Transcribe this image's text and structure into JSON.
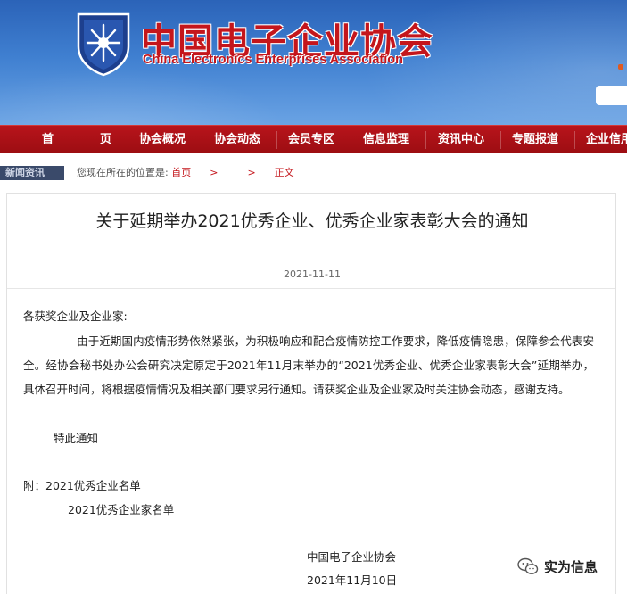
{
  "header": {
    "org_name_cn": "中国电子企业协会",
    "org_name_en": "China Electronics Enterprises Association"
  },
  "nav": {
    "items": [
      {
        "label": "首"
      },
      {
        "label": "页"
      },
      {
        "label": "协会概况"
      },
      {
        "label": "协会动态"
      },
      {
        "label": "会员专区"
      },
      {
        "label": "信息监理"
      },
      {
        "label": "资讯中心"
      },
      {
        "label": "专题报道"
      },
      {
        "label": "企业信用"
      }
    ]
  },
  "breadcrumb": {
    "tag": "新闻资讯",
    "prefix": "您现在所在的位置是:",
    "home": "首页",
    "sep1": ">",
    "sep2": ">",
    "current": "正文"
  },
  "article": {
    "title": "关于延期举办2021优秀企业、优秀企业家表彰大会的通知",
    "date": "2021-11-11",
    "salutation": "各获奖企业及企业家:",
    "body": "由于近期国内疫情形势依然紧张，为积极响应和配合疫情防控工作要求，降低疫情隐患，保障参会代表安全。经协会秘书处办公会研究决定原定于2021年11月末举办的“2021优秀企业、优秀企业家表彰大会”延期举办，具体召开时间，将根据疫情情况及相关部门要求另行通知。请获奖企业及企业家及时关注协会动态，感谢支持。",
    "closing": "特此通知",
    "attachment_1": "附：2021优秀企业名单",
    "attachment_2": "2021优秀企业家名单",
    "signer": "中国电子企业协会",
    "sign_date": "2021年11月10日"
  },
  "watermark": {
    "text": "实为信息",
    "icon": "wechat-icon"
  },
  "colors": {
    "nav_red": "#b8141b",
    "brand_red": "#c4161c",
    "banner_blue": "#3f7fd0"
  }
}
